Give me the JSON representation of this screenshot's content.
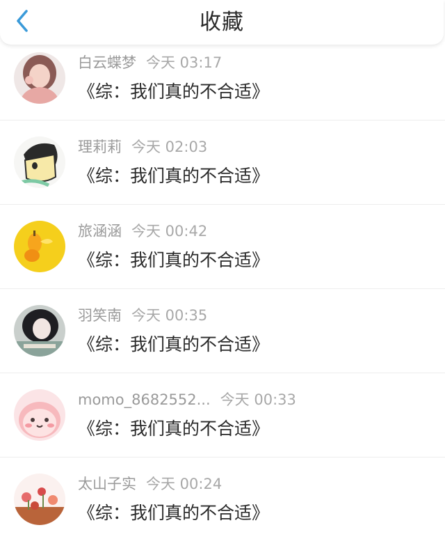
{
  "header": {
    "title": "收藏",
    "back_icon": "chevron-left-icon",
    "accent_color": "#3a9ad9"
  },
  "items": [
    {
      "name": "白云蝶梦",
      "time": "今天 03:17",
      "title": "《综：我们真的不合适》",
      "avatar": "avatar-girl-pink"
    },
    {
      "name": "理莉莉",
      "time": "今天 02:03",
      "title": "《综：我们真的不合适》",
      "avatar": "avatar-cartoon"
    },
    {
      "name": "旅涵涵",
      "time": "今天 00:42",
      "title": "《综：我们真的不合适》",
      "avatar": "avatar-yellow-fruit"
    },
    {
      "name": "羽笑南",
      "time": "今天 00:35",
      "title": "《综：我们真的不合适》",
      "avatar": "avatar-girl-dark"
    },
    {
      "name": "momo_8682552...",
      "time": "今天 00:33",
      "title": "《综：我们真的不合适》",
      "avatar": "avatar-pink-peach"
    },
    {
      "name": "太山子实",
      "time": "今天 00:24",
      "title": "《综：我们真的不合适》",
      "avatar": "avatar-flowers"
    }
  ]
}
